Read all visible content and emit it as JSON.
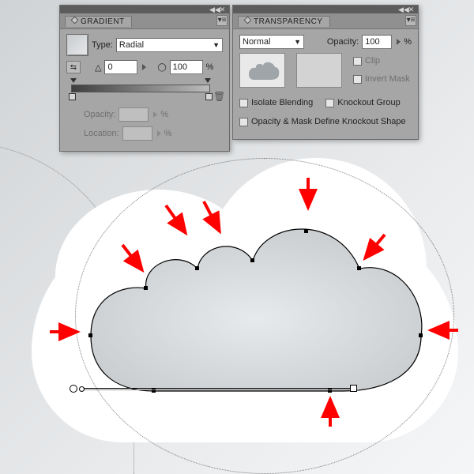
{
  "gradientPanel": {
    "tabLabel": "GRADIENT",
    "typeLabel": "Type:",
    "typeValue": "Radial",
    "angleValue": "0",
    "aspectValue": "100",
    "aspectUnit": "%",
    "opacityLabel": "Opacity:",
    "opacityUnit": "%",
    "locationLabel": "Location:",
    "locationUnit": "%"
  },
  "transparencyPanel": {
    "tabLabel": "TRANSPARENCY",
    "blendMode": "Normal",
    "opacityLabel": "Opacity:",
    "opacityValue": "100",
    "opacityUnit": "%",
    "clipLabel": "Clip",
    "invertLabel": "Invert Mask",
    "isolateLabel": "Isolate Blending",
    "knockoutLabel": "Knockout Group",
    "defineLabel": "Opacity & Mask Define Knockout Shape"
  },
  "icons": {
    "collapse": "◀◀",
    "menu": "✕",
    "fly": "▾≡",
    "caret": "▼",
    "reverse": "⇆",
    "angle": "△",
    "aspect": "◯",
    "trash": "🗑",
    "spin": "▶"
  },
  "arrow_color": "#ff0000"
}
